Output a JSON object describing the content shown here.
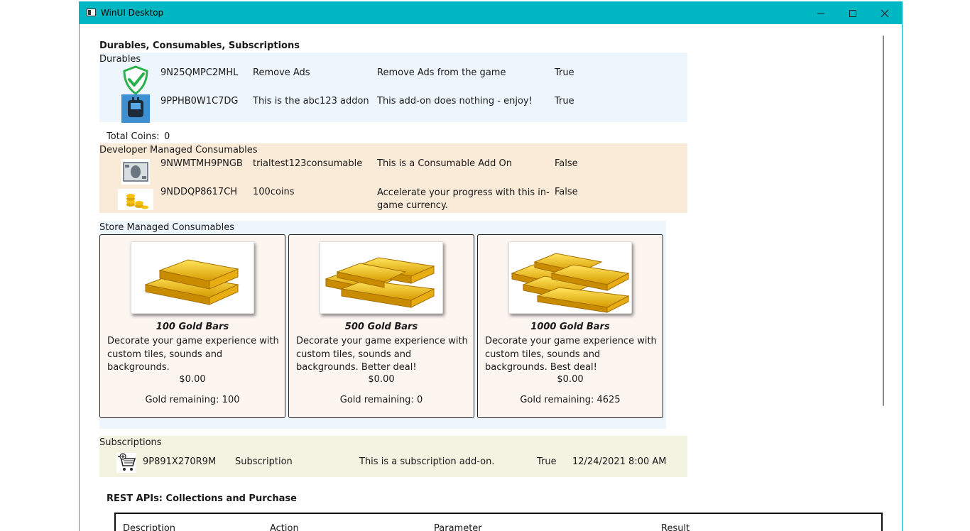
{
  "window": {
    "title": "WinUI Desktop"
  },
  "main": {
    "heading": "Durables, Consumables, Subscriptions",
    "durables": {
      "label": "Durables",
      "items": [
        {
          "icon": "green-check-shield-icon",
          "id": "9N25QMPC2MHL",
          "name": "Remove Ads",
          "description": "Remove Ads from the game",
          "owned": "True"
        },
        {
          "icon": "robot-icon",
          "id": "9PPHB0W1C7DG",
          "name": "This is the abc123 addon",
          "description": "This add-on does nothing - enjoy!",
          "owned": "True"
        }
      ]
    },
    "total_coins": {
      "label": "Total Coins:",
      "value": "0"
    },
    "developer_consumables": {
      "label": "Developer Managed Consumables",
      "items": [
        {
          "icon": "banknote-icon",
          "id": "9NWMTMH9PNGB",
          "name": "trialtest123consumable",
          "description": "This is a Consumable Add On",
          "owned": "False"
        },
        {
          "icon": "coin-stack-icon",
          "id": "9NDDQP8617CH",
          "name": "100coins",
          "description_line1": "Accelerate your progress with this in-",
          "description_line2": "game currency.",
          "owned": "False"
        }
      ]
    },
    "store_consumables": {
      "label": "Store Managed Consumables",
      "cards": [
        {
          "title": "100 Gold Bars",
          "description": "Decorate your game experience with custom tiles, sounds and backgrounds.",
          "price": "$0.00",
          "gold_remaining": "Gold remaining: 100"
        },
        {
          "title": "500 Gold Bars",
          "description": "Decorate your game experience with custom tiles, sounds and backgrounds. Better deal!",
          "price": "$0.00",
          "gold_remaining": "Gold remaining: 0"
        },
        {
          "title": "1000 Gold Bars",
          "description": "Decorate your game experience with custom tiles, sounds and backgrounds. Best deal!",
          "price": "$0.00",
          "gold_remaining": "Gold remaining: 4625"
        }
      ]
    },
    "subscriptions": {
      "label": "Subscriptions",
      "items": [
        {
          "icon": "shopping-cart-icon",
          "id": "9P891X270R9M",
          "name": "Subscription",
          "description": "This is a subscription add-on.",
          "owned": "True",
          "expires": "12/24/2021 8:00 AM"
        }
      ]
    },
    "rest_apis": {
      "heading": "REST APIs: Collections and Purchase",
      "columns": [
        "Description",
        "Action",
        "Parameter",
        "Result"
      ]
    }
  },
  "colors": {
    "titlebar": "#00b7c3",
    "durables_bg": "#edf6fd",
    "dev_consumables_bg": "#faebd8",
    "store_consumables_bg": "#edf6fd",
    "subscriptions_bg": "#f2f3e0",
    "card_bg": "#fdf5f0"
  }
}
